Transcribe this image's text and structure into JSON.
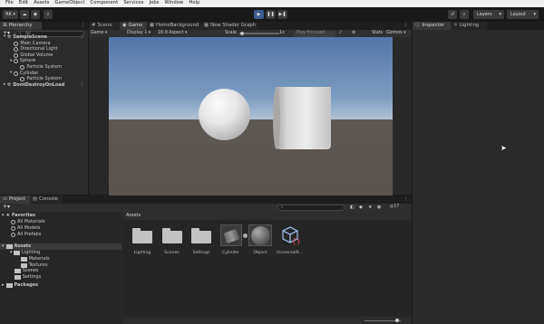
{
  "menubar": {
    "items": [
      "File",
      "Edit",
      "Assets",
      "GameObject",
      "Component",
      "Services",
      "Jobs",
      "Window",
      "Help"
    ]
  },
  "toolbar": {
    "account_label": "RK ▾",
    "layers_label": "Layers",
    "layout_label": "Layout"
  },
  "hierarchy": {
    "tab": "Hierarchy",
    "search_placeholder": "All",
    "items": [
      {
        "label": "SampleScene",
        "indent": 0,
        "kind": "scene"
      },
      {
        "label": "Main Camera",
        "indent": 1,
        "kind": "go"
      },
      {
        "label": "Directional Light",
        "indent": 1,
        "kind": "go"
      },
      {
        "label": "Global Volume",
        "indent": 1,
        "kind": "go"
      },
      {
        "label": "Sphere",
        "indent": 1,
        "kind": "go"
      },
      {
        "label": "Particle System",
        "indent": 2,
        "kind": "go"
      },
      {
        "label": "Cylinder",
        "indent": 1,
        "kind": "go"
      },
      {
        "label": "Particle System",
        "indent": 2,
        "kind": "go"
      },
      {
        "label": "DontDestroyOnLoad",
        "indent": 0,
        "kind": "scene"
      }
    ]
  },
  "center_tabs": [
    "Scene",
    "Game",
    "HomeBackground",
    "New Shader Graph"
  ],
  "game_toolbar": {
    "display_mode": "Game",
    "display": "Display 1",
    "aspect": "16:9 Aspect",
    "scale_label": "Scale",
    "scale_value": "1x",
    "play_focused": "Play Focused",
    "stats": "Stats",
    "gizmos": "Gizmos"
  },
  "inspector_tabs": [
    "Inspector",
    "Lighting"
  ],
  "project": {
    "tabs": [
      "Project",
      "Console"
    ],
    "badge": "17",
    "breadcrumb": "Assets",
    "favorites": {
      "label": "Favorites",
      "items": [
        "All Materials",
        "All Models",
        "All Prefabs"
      ]
    },
    "assets_tree": {
      "label": "Assets",
      "items": [
        {
          "label": "Lighting",
          "indent": 1
        },
        {
          "label": "Materials",
          "indent": 2
        },
        {
          "label": "Textures",
          "indent": 2
        },
        {
          "label": "Scenes",
          "indent": 1
        },
        {
          "label": "Settings",
          "indent": 1
        }
      ]
    },
    "packages_label": "Packages",
    "grid": [
      {
        "label": "Lighting",
        "type": "folder"
      },
      {
        "label": "Scenes",
        "type": "folder"
      },
      {
        "label": "Settings",
        "type": "folder"
      },
      {
        "label": "Cylinder",
        "type": "model"
      },
      {
        "label": "Object",
        "type": "sphere"
      },
      {
        "label": "UniversalR...",
        "type": "urp"
      }
    ]
  },
  "colors": {
    "accent": "#3c5a8c",
    "panel": "#2b2b2b",
    "sky_top": "#5276a8",
    "ground": "#5e5853"
  }
}
